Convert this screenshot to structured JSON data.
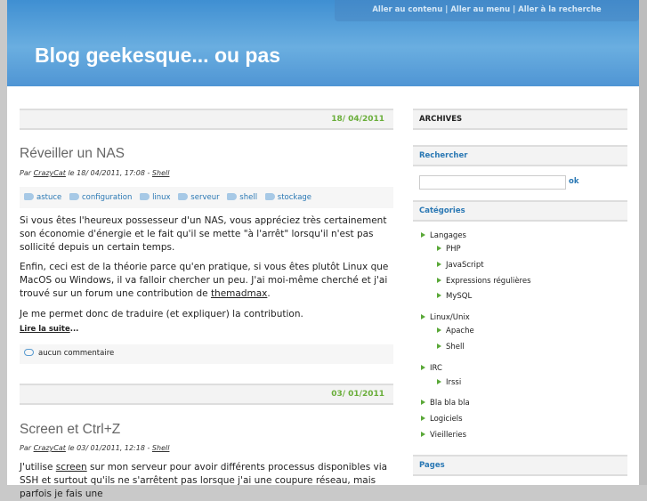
{
  "header": {
    "title": "Blog geekesque... ou pas",
    "skip_links": [
      "Aller au contenu",
      "Aller au menu",
      "Aller à la recherche"
    ],
    "separator": "|"
  },
  "posts": [
    {
      "date": "18/ 04/2011",
      "title": "Réveiller un NAS",
      "meta": {
        "by": "Par",
        "author": "CrazyCat",
        "le": "le 18/ 04/2011, 17:08 -",
        "category": "Shell"
      },
      "tags": [
        "astuce",
        "configuration",
        "linux",
        "serveur",
        "shell",
        "stockage"
      ],
      "paragraphs": [
        "Si vous êtes l'heureux possesseur d'un NAS, vous appréciez très certainement son économie d'énergie et le fait qu'il se mette \"à l'arrêt\" lorsqu'il n'est pas sollicité depuis un certain temps.",
        "Enfin, ceci est de la théorie parce qu'en pratique, si vous êtes plutôt Linux que MacOS ou Windows, il va falloir chercher un peu. J'ai moi-même cherché et j'ai trouvé sur un forum une contribution de",
        "Je me permet donc de traduire (et expliquer) la contribution."
      ],
      "link_user": "themadmax",
      "read_more": "Lire la suite",
      "ellipsis": "...",
      "comments": "aucun commentaire"
    },
    {
      "date": "03/ 01/2011",
      "title": "Screen et Ctrl+Z",
      "meta": {
        "by": "Par",
        "author": "CrazyCat",
        "le": "le 03/ 01/2011, 12:18 -",
        "category": "Shell"
      },
      "p_before": "J'utilise",
      "p_link": "screen",
      "p_after": "sur mon serveur pour avoir différents processus disponibles via SSH et surtout qu'ils ne s'arrêtent pas lorsque j'ai une coupure réseau, mais parfois je fais une"
    }
  ],
  "sidebar": {
    "archives": "ARCHIVES",
    "search_title": "Rechercher",
    "search_value": "",
    "search_button": "ok",
    "categories_title": "Catégories",
    "pages_title": "Pages",
    "categories": [
      {
        "label": "Langages",
        "children": [
          "PHP",
          "JavaScript",
          "Expressions régulières",
          "MySQL"
        ]
      },
      {
        "label": "Linux/Unix",
        "children": [
          "Apache",
          "Shell"
        ]
      },
      {
        "label": "IRC",
        "children": [
          "Irssi"
        ]
      },
      {
        "label": "Bla bla bla",
        "children": []
      },
      {
        "label": "Logiciels",
        "children": []
      },
      {
        "label": "Vieilleries",
        "children": []
      }
    ]
  }
}
